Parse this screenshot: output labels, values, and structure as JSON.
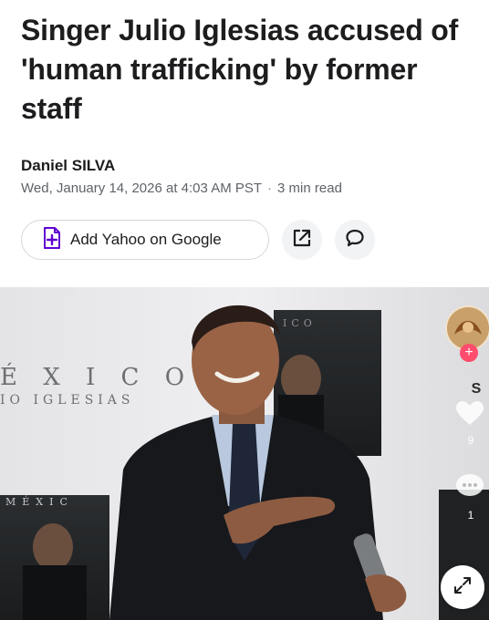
{
  "article": {
    "headline": "Singer Julio Iglesias accused of 'human trafficking' by former staff",
    "author": "Daniel SILVA",
    "date": "Wed, January 14, 2026 at 4:03 AM PST",
    "read_time": "3 min read"
  },
  "actions": {
    "add_google_label": "Add Yahoo on Google",
    "icons": [
      "plus-document-icon",
      "share-external-icon",
      "comment-icon"
    ]
  },
  "photo": {
    "backdrop_text_1": "É X I C O",
    "backdrop_text_2": "IO IGLESIAS",
    "backdrop_text_3": "MÉXIC",
    "backdrop_text_4": "ICO",
    "overlay_rail": {
      "like_count": "9",
      "comment_count": "1",
      "brand_letter": "S"
    }
  },
  "colors": {
    "text_primary": "#1d1d1f",
    "text_secondary": "#5f6368",
    "accent_purple": "#6001d2",
    "button_bg": "#f2f3f5"
  }
}
